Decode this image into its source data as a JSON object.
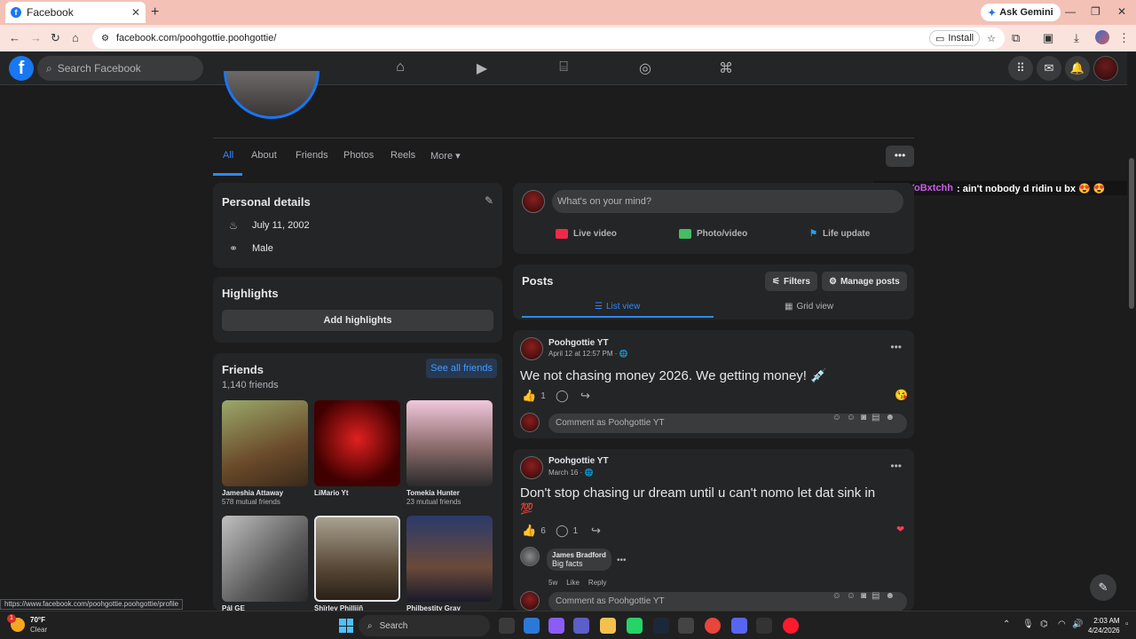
{
  "browser": {
    "tab_title": "Facebook",
    "ask_gemini": "Ask Gemini",
    "url": "facebook.com/poohgottie.poohgottie/",
    "install": "Install",
    "status_url": "https://www.facebook.com/poohgottie.poohgottie/profile"
  },
  "fb": {
    "logo": "f",
    "search_placeholder": "Search Facebook"
  },
  "profile_tabs": [
    "All",
    "About",
    "Friends",
    "Photos",
    "Reels",
    "More ▾"
  ],
  "overlay_chat": {
    "username": "TakeYoBxtchh",
    "message": ": ain't nobody d ridin u bx 😍 😍"
  },
  "personal_details": {
    "title": "Personal details",
    "birthday": "July 11, 2002",
    "gender": "Male"
  },
  "highlights": {
    "title": "Highlights",
    "add_button": "Add highlights"
  },
  "friends": {
    "title": "Friends",
    "count": "1,140 friends",
    "see_all": "See all friends",
    "items": [
      {
        "name": "Jameshia Attaway",
        "mutual": "578 mutual friends",
        "color": "#7a6a3c"
      },
      {
        "name": "LiMario Yt",
        "mutual": "",
        "color": "#8b1111"
      },
      {
        "name": "Tomekia Hunter",
        "mutual": "23 mutual friends",
        "color": "#c9a0b4"
      },
      {
        "name": "PáI GE",
        "mutual": "",
        "color": "#8a8a8a"
      },
      {
        "name": "Śhïrley Philliiñ",
        "mutual": "",
        "color": "#7e6a52"
      },
      {
        "name": "Philbestity Gray",
        "mutual": "",
        "color": "#3a4b7a"
      }
    ]
  },
  "composer": {
    "placeholder": "What's on your mind?",
    "live_video": "Live video",
    "photo_video": "Photo/video",
    "life_update": "Life update"
  },
  "posts_header": {
    "title": "Posts",
    "filters": "Filters",
    "manage_posts": "Manage posts",
    "list_view": "List view",
    "grid_view": "Grid view"
  },
  "posts": [
    {
      "author": "Poohgottie YT",
      "date": "April 12 at 12:57 PM · 🌐",
      "text": "We not chasing money 2026. We getting money! 💉",
      "likes": "1",
      "comments": "",
      "reaction": "😘",
      "comment_placeholder": "Comment as Poohgottie YT"
    },
    {
      "author": "Poohgottie YT",
      "date": "March 16 · 🌐",
      "text": "Don't stop chasing ur dream until u can't nomo let dat sink in",
      "text2": "💯",
      "likes": "6",
      "comments": "1",
      "reaction": "❤",
      "reply": {
        "name": "James Bradford",
        "text": "Big facts",
        "time": "5w",
        "like": "Like",
        "reply": "Reply"
      },
      "comment_placeholder": "Comment as Poohgottie YT"
    }
  ],
  "taskbar": {
    "temp": "70°F",
    "condition": "Clear",
    "alert_count": "1",
    "search": "Search",
    "time": "2:03 AM",
    "date": "4/24/2026"
  },
  "colors": {
    "accent": "#2d88ff",
    "fb_blue": "#1877f2",
    "card": "#242526",
    "background": "#1c1c1d"
  }
}
